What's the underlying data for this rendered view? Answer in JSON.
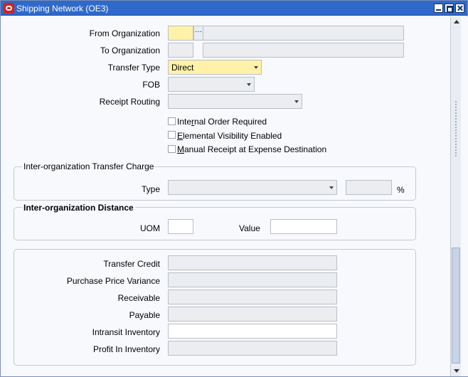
{
  "window": {
    "title": "Shipping Network (OE3)",
    "accent": "#2f69c9"
  },
  "form": {
    "from_org": {
      "label": "From Organization",
      "code": "",
      "name": ""
    },
    "to_org": {
      "label": "To Organization",
      "code": "",
      "name": ""
    },
    "transfer_type": {
      "label": "Transfer Type",
      "value": "Direct"
    },
    "fob": {
      "label": "FOB",
      "value": ""
    },
    "receipt_routing": {
      "label": "Receipt Routing",
      "value": ""
    },
    "checkboxes": [
      {
        "pre": "Inte",
        "u": "r",
        "post": "nal Order Required",
        "checked": false
      },
      {
        "pre": "",
        "u": "E",
        "post": "lemental Visibility Enabled",
        "checked": false
      },
      {
        "pre": "",
        "u": "M",
        "post": "anual Receipt at Expense Destination",
        "checked": false
      }
    ]
  },
  "transfer_charge": {
    "title": "Inter-organization Transfer Charge",
    "type_label": "Type",
    "type_value": "",
    "percent_value": "",
    "percent_sign": "%"
  },
  "distance": {
    "title": "Inter-organization Distance",
    "uom_label": "UOM",
    "uom_value": "",
    "value_label": "Value",
    "value_value": ""
  },
  "accounts": [
    {
      "label": "Transfer Credit",
      "value": ""
    },
    {
      "label": "Purchase Price Variance",
      "value": ""
    },
    {
      "label": "Receivable",
      "value": ""
    },
    {
      "label": "Payable",
      "value": ""
    },
    {
      "label": "Intransit Inventory",
      "value": ""
    },
    {
      "label": "Profit In Inventory",
      "value": ""
    }
  ]
}
